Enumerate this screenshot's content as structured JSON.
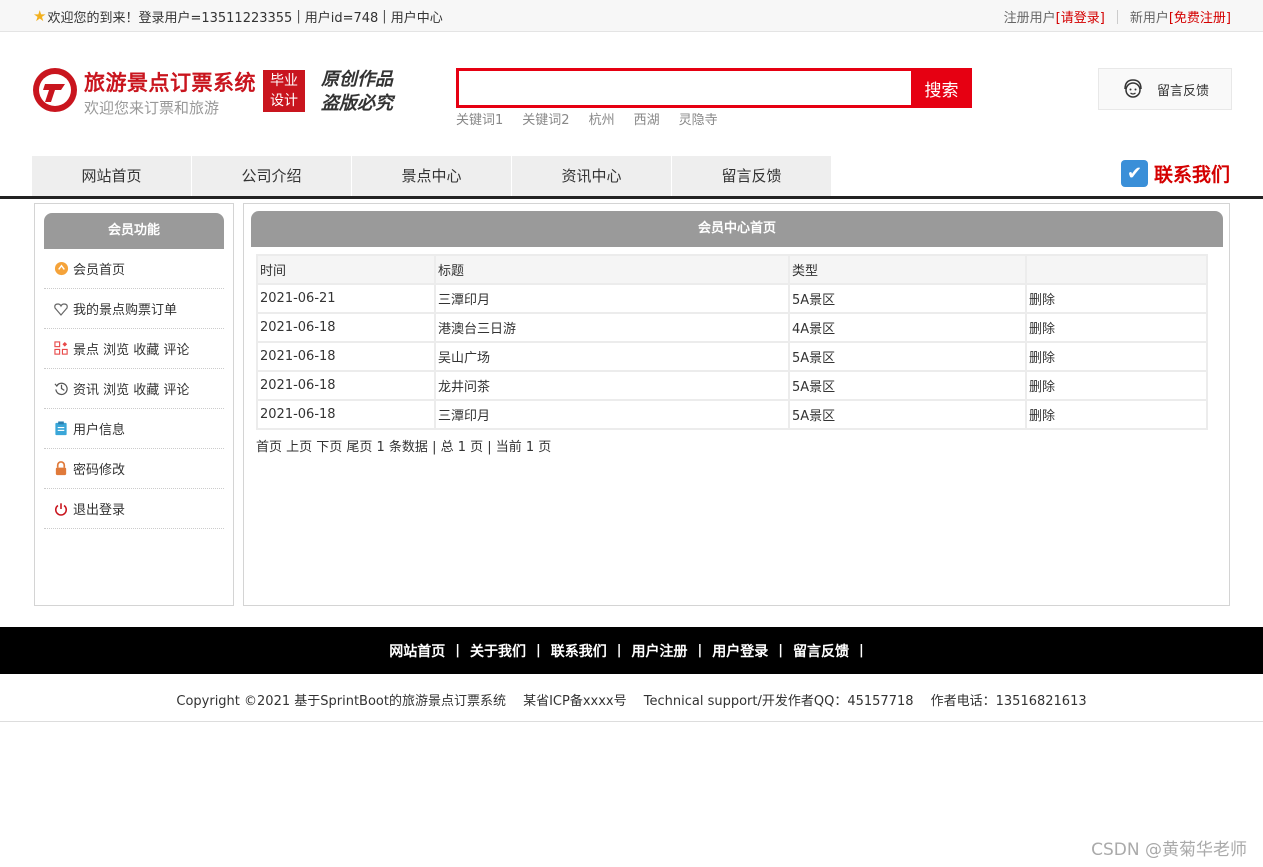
{
  "topbar": {
    "welcome": "欢迎您的到来！登录用户=13511223355",
    "user_id": "用户id=748",
    "user_center": "用户中心",
    "register_user": "注册用户",
    "login": "[请登录]",
    "new_user": "新用户",
    "free_register": "[免费注册]"
  },
  "header": {
    "site_title": "旅游景点订票系统",
    "site_sub": "欢迎您来订票和旅游",
    "badge_line1": "毕业",
    "badge_line2": "设计",
    "slogan_line1": "原创作品",
    "slogan_line2": "盗版必究",
    "search_placeholder": "",
    "search_button": "搜索",
    "keywords": [
      "关键词1",
      "关键词2",
      "杭州",
      "西湖",
      "灵隐寺"
    ],
    "feedback": "留言反馈"
  },
  "nav": {
    "items": [
      "网站首页",
      "公司介绍",
      "景点中心",
      "资讯中心",
      "留言反馈"
    ],
    "contact": "联系我们"
  },
  "sidebar": {
    "title": "会员功能",
    "items": [
      {
        "label": "会员首页",
        "icon": "home-icon"
      },
      {
        "label": "我的景点购票订单",
        "icon": "heart-icon"
      },
      {
        "label": "景点 浏览 收藏 评论",
        "icon": "grid-icon"
      },
      {
        "label": "资讯 浏览 收藏 评论",
        "icon": "history-icon"
      },
      {
        "label": "用户信息",
        "icon": "clipboard-icon"
      },
      {
        "label": "密码修改",
        "icon": "lock-icon"
      },
      {
        "label": "退出登录",
        "icon": "power-icon"
      }
    ]
  },
  "main": {
    "title": "会员中心首页",
    "columns": [
      "时间",
      "标题",
      "类型",
      ""
    ],
    "rows": [
      {
        "time": "2021-06-21",
        "title": "三潭印月",
        "type": "5A景区",
        "action": "删除"
      },
      {
        "time": "2021-06-18",
        "title": "港澳台三日游",
        "type": "4A景区",
        "action": "删除"
      },
      {
        "time": "2021-06-18",
        "title": "吴山广场",
        "type": "5A景区",
        "action": "删除"
      },
      {
        "time": "2021-06-18",
        "title": "龙井问茶",
        "type": "5A景区",
        "action": "删除"
      },
      {
        "time": "2021-06-18",
        "title": "三潭印月",
        "type": "5A景区",
        "action": "删除"
      }
    ],
    "pager": "首页 上页 下页 尾页 1 条数据 | 总 1 页 | 当前 1 页"
  },
  "footer": {
    "links": [
      "网站首页",
      "关于我们",
      "联系我们",
      "用户注册",
      "用户登录",
      "留言反馈"
    ],
    "copyright": "Copyright ©2021 基于SprintBoot的旅游景点订票系统　 某省ICP备xxxx号　 Technical support/开发作者QQ：45157718　 作者电话：13516821613",
    "watermark": "CSDN @黄菊华老师"
  },
  "colors": {
    "brand_red": "#c9151e",
    "search_red": "#e60012",
    "panel_gray": "#9a9a9a",
    "footer_black": "#000000"
  }
}
